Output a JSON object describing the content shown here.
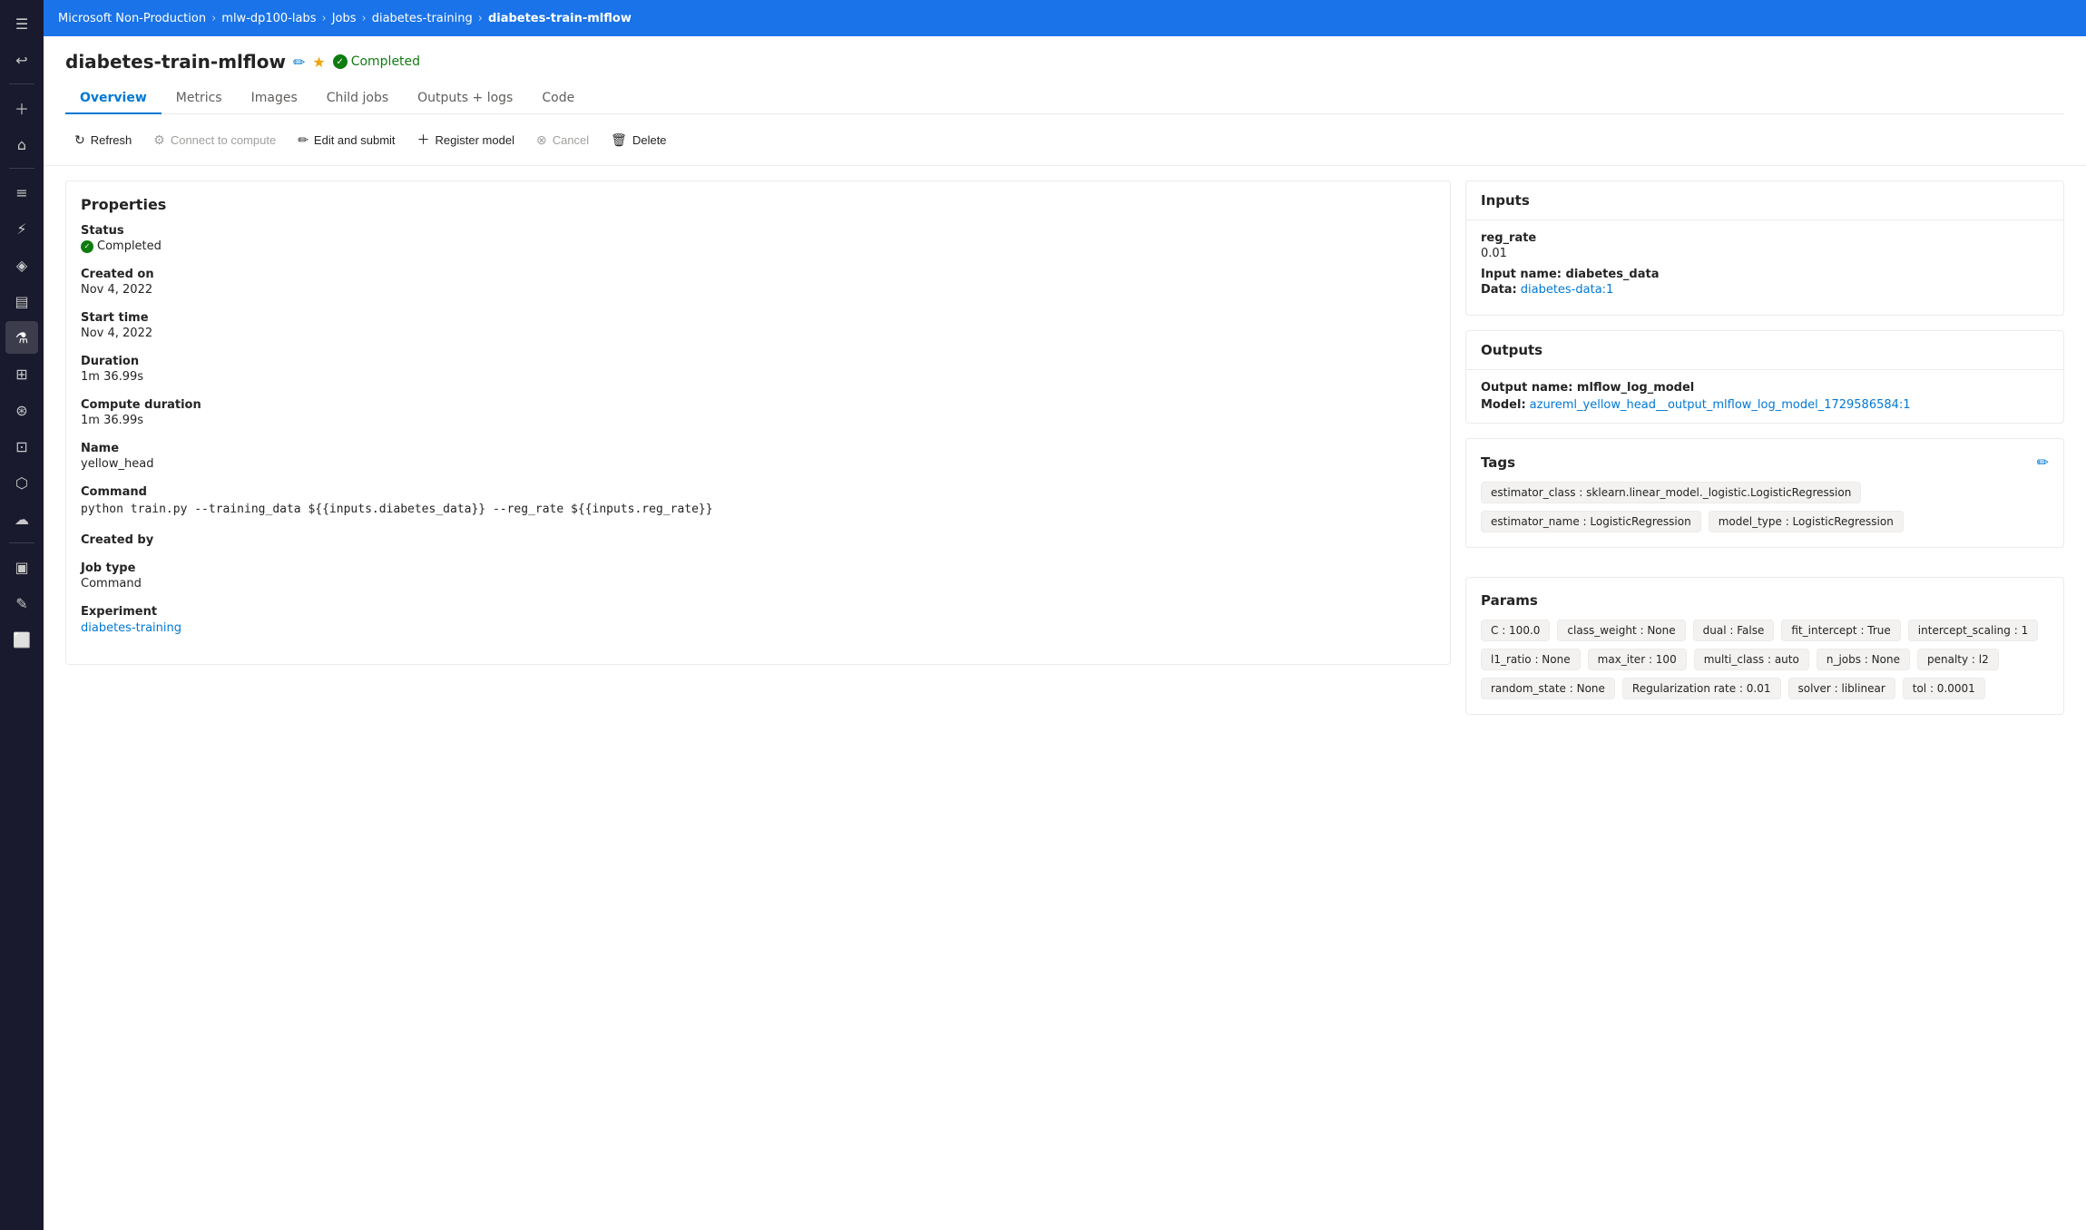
{
  "topbar": {
    "items": [
      {
        "label": "Microsoft Non-Production",
        "current": false
      },
      {
        "label": "mlw-dp100-labs",
        "current": false
      },
      {
        "label": "Jobs",
        "current": false
      },
      {
        "label": "diabetes-training",
        "current": false
      },
      {
        "label": "diabetes-train-mlflow",
        "current": true
      }
    ],
    "separator": "›"
  },
  "page": {
    "title": "diabetes-train-mlflow",
    "status": "Completed"
  },
  "tabs": [
    {
      "label": "Overview",
      "active": true
    },
    {
      "label": "Metrics",
      "active": false
    },
    {
      "label": "Images",
      "active": false
    },
    {
      "label": "Child jobs",
      "active": false
    },
    {
      "label": "Outputs + logs",
      "active": false
    },
    {
      "label": "Code",
      "active": false
    }
  ],
  "toolbar": {
    "refresh": "Refresh",
    "connect": "Connect to compute",
    "edit": "Edit and submit",
    "register": "Register model",
    "cancel": "Cancel",
    "delete": "Delete"
  },
  "properties": {
    "title": "Properties",
    "status_label": "Status",
    "status_value": "Completed",
    "created_label": "Created on",
    "created_value": "Nov 4, 2022",
    "start_label": "Start time",
    "start_value": "Nov 4, 2022",
    "duration_label": "Duration",
    "duration_value": "1m 36.99s",
    "compute_duration_label": "Compute duration",
    "compute_duration_value": "1m 36.99s",
    "name_label": "Name",
    "name_value": "yellow_head",
    "command_label": "Command",
    "command_value": "python train.py --training_data ${{inputs.diabetes_data}} --reg_rate ${{inputs.reg_rate}}",
    "created_by_label": "Created by",
    "created_by_value": "",
    "job_type_label": "Job type",
    "job_type_value": "Command",
    "experiment_label": "Experiment",
    "experiment_value": "diabetes-training"
  },
  "inputs": {
    "title": "Inputs",
    "reg_rate_label": "reg_rate",
    "reg_rate_value": "0.01",
    "input_name_label": "Input name: diabetes_data",
    "data_label": "Data:",
    "data_value": "diabetes-data:1"
  },
  "outputs": {
    "title": "Outputs",
    "output_name": "Output name: mlflow_log_model",
    "model_label": "Model:",
    "model_value": "azureml_yellow_head__output_mlflow_log_model_1729586584:1"
  },
  "tags": {
    "title": "Tags",
    "items": [
      "estimator_class : sklearn.linear_model._logistic.LogisticRegression",
      "estimator_name : LogisticRegression",
      "model_type : LogisticRegression"
    ]
  },
  "params": {
    "title": "Params",
    "items": [
      "C : 100.0",
      "class_weight : None",
      "dual : False",
      "fit_intercept : True",
      "intercept_scaling : 1",
      "l1_ratio : None",
      "max_iter : 100",
      "multi_class : auto",
      "n_jobs : None",
      "penalty : l2",
      "random_state : None",
      "Regularization rate : 0.01",
      "solver : liblinear",
      "tol : 0.0001"
    ]
  },
  "sidebar": {
    "icons": [
      {
        "name": "menu",
        "symbol": "☰",
        "active": false
      },
      {
        "name": "back",
        "symbol": "←",
        "active": false
      },
      {
        "name": "add",
        "symbol": "+",
        "active": false
      },
      {
        "name": "home",
        "symbol": "⌂",
        "active": false
      },
      {
        "name": "list",
        "symbol": "☰",
        "active": false
      },
      {
        "name": "chart",
        "symbol": "⚡",
        "active": false
      },
      {
        "name": "network",
        "symbol": "◈",
        "active": false
      },
      {
        "name": "compute",
        "symbol": "▤",
        "active": false
      },
      {
        "name": "lab",
        "symbol": "⚗",
        "active": true
      },
      {
        "name": "dashboard",
        "symbol": "⊞",
        "active": false
      },
      {
        "name": "data",
        "symbol": "⊛",
        "active": false
      },
      {
        "name": "stack",
        "symbol": "⊡",
        "active": false
      },
      {
        "name": "box",
        "symbol": "⬡",
        "active": false
      },
      {
        "name": "cloud",
        "symbol": "☁",
        "active": false
      },
      {
        "name": "monitor",
        "symbol": "▣",
        "active": false
      },
      {
        "name": "pencil",
        "symbol": "✎",
        "active": false
      },
      {
        "name": "square",
        "symbol": "⬜",
        "active": false
      }
    ]
  }
}
